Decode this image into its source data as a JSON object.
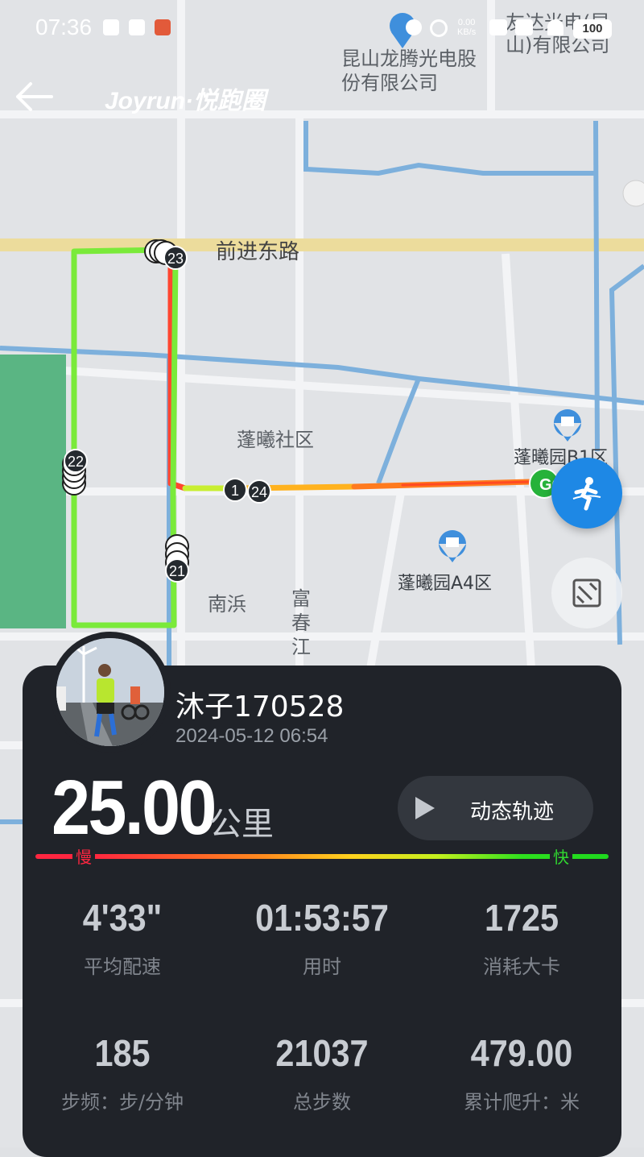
{
  "status_bar": {
    "time": "07:36",
    "net_speed_value": "0.00",
    "net_speed_unit": "KB/s",
    "battery": "100"
  },
  "header": {
    "brand": "Joyrun·悦跑圈"
  },
  "map": {
    "labels": {
      "company1": "昆山龙腾光电股份有限公司",
      "company2": "友达光电(昆山)有限公司",
      "road_main": "前进东路",
      "community": "蓬曦社区",
      "area_b1": "蓬曦园B1区",
      "area_a4": "蓬曦园A4区",
      "nanbang": "南浜",
      "fuchun": "富春江"
    },
    "markers": [
      "23",
      "22",
      "1",
      "24",
      "21"
    ],
    "start_marker": "GO",
    "colors": {
      "route_fast": "#6ee33a",
      "route_slow": "#ff3b2e",
      "runner_button": "#1e88e5"
    }
  },
  "run": {
    "user": "沐子170528",
    "datetime": "2024-05-12 06:54",
    "distance": "25.00",
    "distance_unit": "公里",
    "replay_label": "动态轨迹",
    "pace_slow": "慢",
    "pace_fast": "快",
    "stats": [
      {
        "value": "4'33\"",
        "label": "平均配速"
      },
      {
        "value": "01:53:57",
        "label": "用时"
      },
      {
        "value": "1725",
        "label": "消耗大卡"
      },
      {
        "value": "185",
        "label": "步频：步/分钟"
      },
      {
        "value": "21037",
        "label": "总步数"
      },
      {
        "value": "479.00",
        "label": "累计爬升：米"
      }
    ]
  }
}
